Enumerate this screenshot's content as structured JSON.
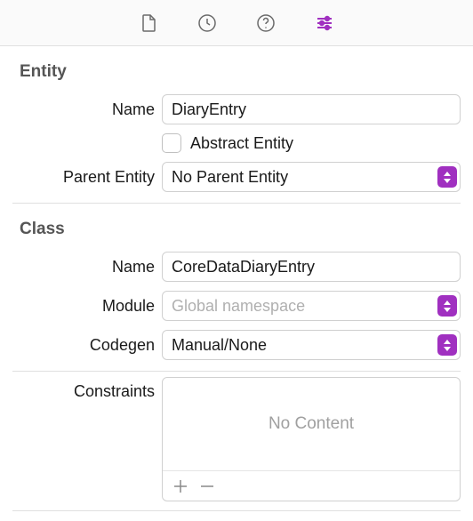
{
  "entity": {
    "section_title": "Entity",
    "name_label": "Name",
    "name_value": "DiaryEntry",
    "abstract_label": "Abstract Entity",
    "abstract_checked": false,
    "parent_label": "Parent Entity",
    "parent_value": "No Parent Entity"
  },
  "class": {
    "section_title": "Class",
    "name_label": "Name",
    "name_value": "CoreDataDiaryEntry",
    "module_label": "Module",
    "module_placeholder": "Global namespace",
    "module_value": "",
    "codegen_label": "Codegen",
    "codegen_value": "Manual/None",
    "constraints_label": "Constraints",
    "constraints_empty": "No Content"
  }
}
